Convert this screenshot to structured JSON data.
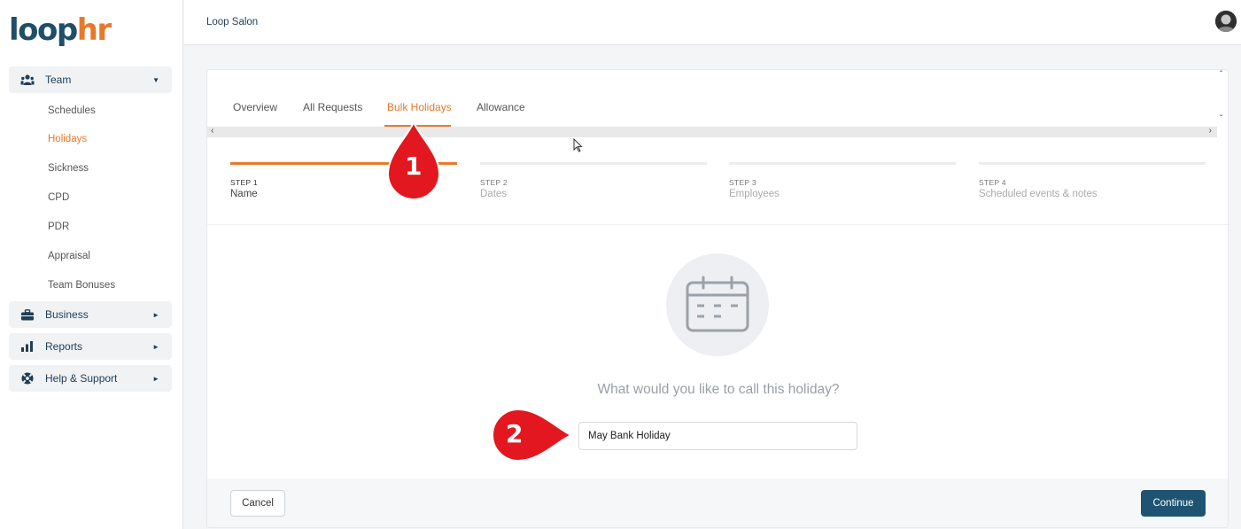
{
  "logo": {
    "part1": "loop",
    "part2": "hr"
  },
  "header": {
    "salon_name": "Loop Salon"
  },
  "sidebar": {
    "groups": [
      {
        "label": "Team",
        "icon": "team-icon",
        "caret": "▼"
      },
      {
        "label": "Business",
        "icon": "briefcase-icon",
        "caret": "►"
      },
      {
        "label": "Reports",
        "icon": "bar-chart-icon",
        "caret": "►"
      },
      {
        "label": "Help & Support",
        "icon": "lifebuoy-icon",
        "caret": "►"
      }
    ],
    "team_items": [
      "Schedules",
      "Holidays",
      "Sickness",
      "CPD",
      "PDR",
      "Appraisal",
      "Team Bonuses"
    ],
    "active_item": "Holidays"
  },
  "tabs": [
    "Overview",
    "All Requests",
    "Bulk Holidays",
    "Allowance"
  ],
  "active_tab": "Bulk Holidays",
  "steps": [
    {
      "num": "STEP 1",
      "label": "Name"
    },
    {
      "num": "STEP 2",
      "label": "Dates"
    },
    {
      "num": "STEP 3",
      "label": "Employees"
    },
    {
      "num": "STEP 4",
      "label": "Scheduled events & notes"
    }
  ],
  "form": {
    "question": "What would you like to call this holiday?",
    "holiday_name_value": "May Bank Holiday"
  },
  "buttons": {
    "cancel": "Cancel",
    "continue": "Continue"
  },
  "annotations": [
    "1",
    "2"
  ],
  "colors": {
    "accent": "#e8792b",
    "primary": "#1f5372",
    "marker": "#e3171f"
  }
}
